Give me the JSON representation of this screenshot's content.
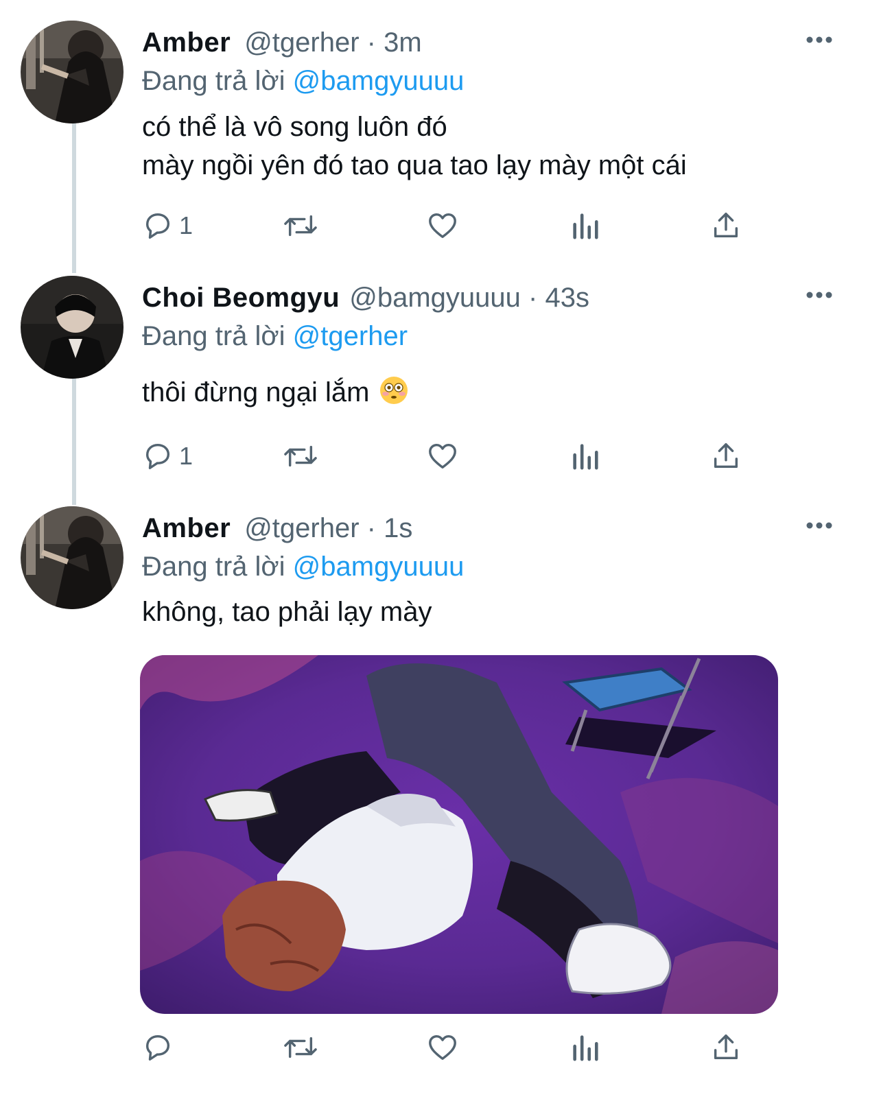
{
  "tweets": [
    {
      "name": "Amber",
      "handle": "@tgerher",
      "separator": "·",
      "time": "3m",
      "reply_label": "Đang trả lời",
      "reply_to": "@bamgyuuuu",
      "text_lines": [
        "có thể là vô song luôn đó",
        "mày ngồi yên đó tao qua tao lạy mày một cái"
      ],
      "reply_count": "1"
    },
    {
      "name": "Choi Beomgyu",
      "handle": "@bamgyuuuu",
      "separator": "·",
      "time": "43s",
      "reply_label": "Đang trả lời",
      "reply_to": "@tgerher",
      "text_lines": [
        "thôi đừng ngại lắm"
      ],
      "emoji": "flushed-face",
      "reply_count": "1"
    },
    {
      "name": "Amber",
      "handle": "@tgerher",
      "separator": "·",
      "time": "1s",
      "reply_label": "Đang trả lời",
      "reply_to": "@bamgyuuuu",
      "text_lines": [
        "không, tao phải lạy mày"
      ],
      "media": "anime-character-bowing-image",
      "reply_count": ""
    }
  ],
  "icons": [
    "more-icon",
    "reply-icon",
    "retweet-icon",
    "like-icon",
    "analytics-icon",
    "share-icon"
  ],
  "colors": {
    "link": "#1d9bf0",
    "secondary": "#536471",
    "text": "#0f1419",
    "thread_line": "#cfd9de"
  }
}
